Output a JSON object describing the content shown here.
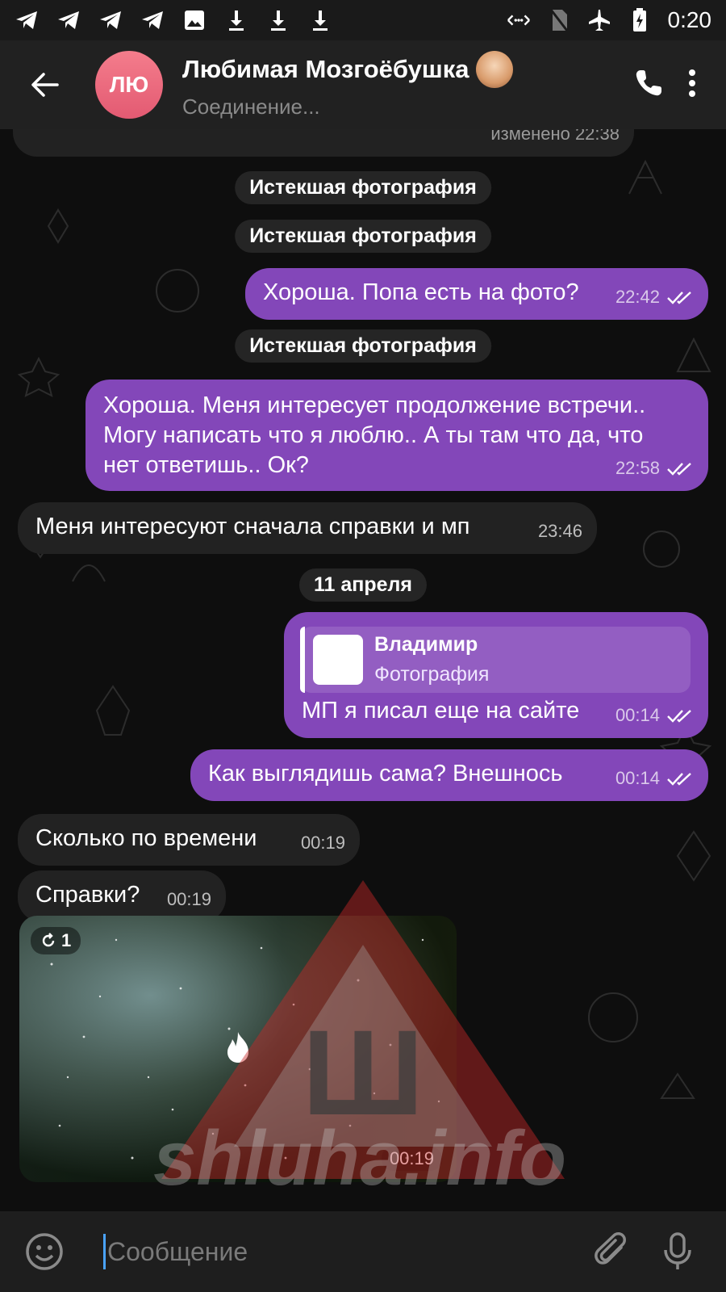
{
  "status_bar": {
    "time": "0:20",
    "icons": [
      "telegram-icon",
      "telegram-icon",
      "telegram-icon",
      "telegram-icon",
      "image-icon",
      "download-icon",
      "download-icon",
      "download-icon"
    ],
    "right_icons": [
      "data-saver-icon",
      "no-sim-icon",
      "airplane-icon",
      "battery-charging-icon"
    ]
  },
  "header": {
    "avatar_initials": "ЛЮ",
    "title": "Любимая Мозгоёбушка",
    "status": "Соединение..."
  },
  "messages": {
    "edited_label": "изменено 22:38",
    "service1": "Истекшая фотография",
    "service2": "Истекшая фотография",
    "out1_text": "Хороша. Попа есть на фото?",
    "out1_time": "22:42",
    "service3": "Истекшая фотография",
    "out2_text": "Хороша. Меня интересует продолжение встречи.. Могу написать что я люблю.. А ты там что да, что нет ответишь.. Ок?",
    "out2_time": "22:58",
    "in1_text": "Меня интересуют сначала справки и мп",
    "in1_time": "23:46",
    "date_sep": "11 апреля",
    "reply_name": "Владимир",
    "reply_sub": "Фотография",
    "out3_text": "МП я писал еще на сайте",
    "out3_time": "00:14",
    "out4_text": "Как выглядишь сама? Внешнось",
    "out4_time": "00:14",
    "in2_text": "Сколько по времени",
    "in2_time": "00:19",
    "in3_text": "Справки?",
    "in3_time": "00:19",
    "photo_badge": "1",
    "photo_time": "00:19"
  },
  "watermark": {
    "text": "shluha.info",
    "glyph": "Ш"
  },
  "input": {
    "placeholder": "Сообщение"
  },
  "colors": {
    "outgoing": "#8347b9",
    "incoming": "#222222",
    "avatar": "#e35a72"
  }
}
